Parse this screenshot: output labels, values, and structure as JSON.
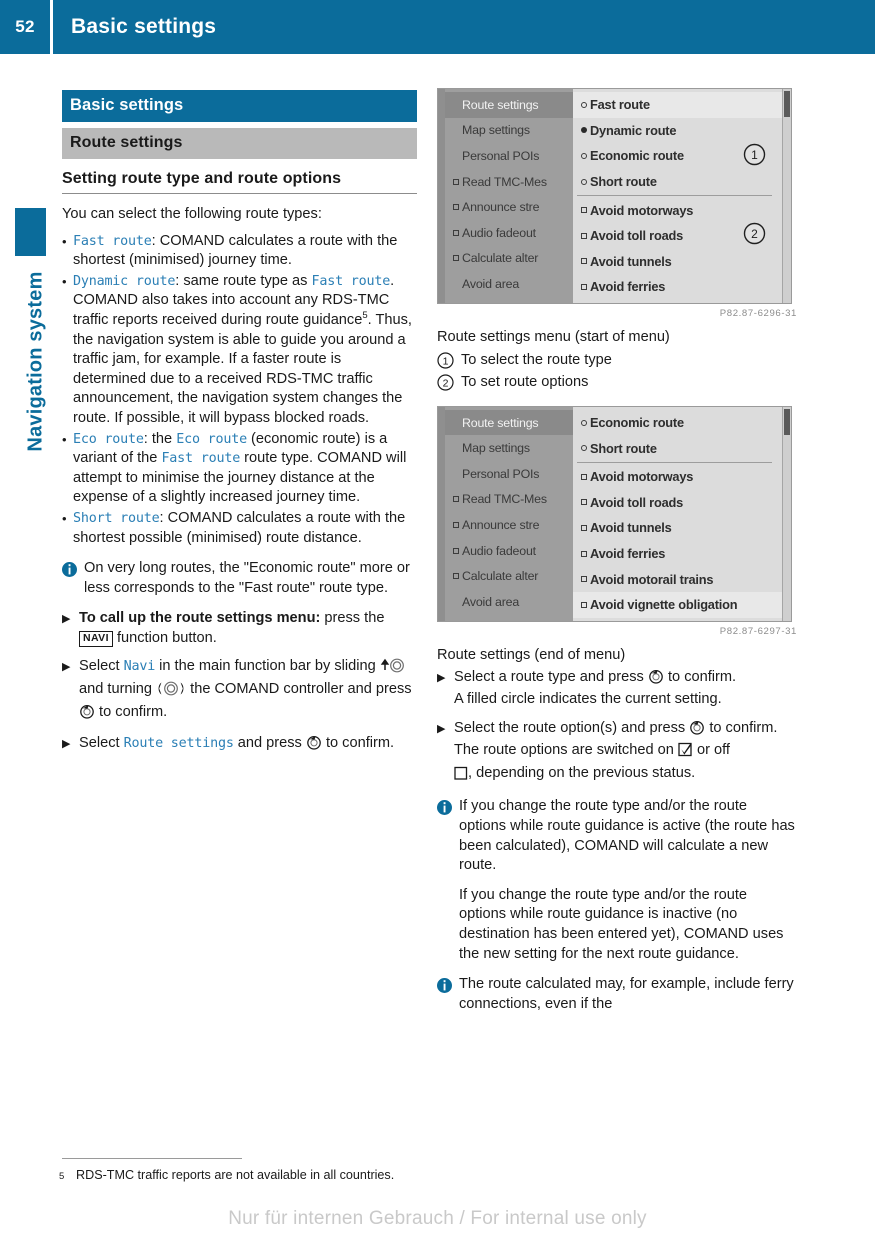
{
  "header": {
    "page_number": "52",
    "title": "Basic settings"
  },
  "chapter_tab": {
    "label": "Navigation system"
  },
  "left_column": {
    "section_bar": "Basic settings",
    "subsection_bar": "Route settings",
    "heading": "Setting route type and route options",
    "intro": "You can select the following route types:",
    "bullets": [
      {
        "term": "Fast route",
        "text": ": COMAND calculates a route with the shortest (minimised) journey time."
      },
      {
        "term": "Dynamic route",
        "text": ": same route type as Fast route. COMAND also takes into account any RDS-TMC traffic reports received during route guidance5. Thus, the navigation system is able to guide you around a traffic jam, for example. If a faster route is determined due to a received RDS-TMC traffic announcement, the navigation system changes the route. If possible, it will bypass blocked roads."
      },
      {
        "term": "Eco route",
        "text": ": the Eco route (economic route) is a variant of the Fast route route type. COMAND will attempt to minimise the journey distance at the expense of a slightly increased journey time."
      },
      {
        "term": "Short route",
        "text": ": COMAND calculates a route with the shortest possible (minimised) route distance."
      }
    ],
    "info_note": "On very long routes, the \"Economic route\" more or less corresponds to the \"Fast route\" route type.",
    "steps": [
      {
        "bold_lead": "To call up the route settings menu:",
        "text": "press the NAVI function button.",
        "button_label": "NAVI"
      },
      {
        "text": "Select Navi in the main function bar by sliding and turning the COMAND controller and press to confirm.",
        "ui_terms": [
          "Navi"
        ]
      },
      {
        "text": "Select Route settings and press to confirm.",
        "ui_terms": [
          "Route settings"
        ]
      }
    ]
  },
  "right_column": {
    "figure_1": {
      "code": "P82.87-6296-31",
      "menu_items": [
        {
          "label": "Route settings",
          "marker": "none",
          "highlighted": true
        },
        {
          "label": "Map settings",
          "marker": "none",
          "highlighted": false
        },
        {
          "label": "Personal POIs",
          "marker": "none",
          "highlighted": false
        },
        {
          "label": "Read TMC-Mes",
          "marker": "square",
          "highlighted": false
        },
        {
          "label": "Announce stre",
          "marker": "square",
          "highlighted": false
        },
        {
          "label": "Audio fadeout",
          "marker": "square",
          "highlighted": false
        },
        {
          "label": "Calculate alter",
          "marker": "square",
          "highlighted": false
        },
        {
          "label": "Avoid area",
          "marker": "none",
          "highlighted": false
        }
      ],
      "list_items": [
        {
          "label": "Fast route",
          "marker": "ring",
          "highlighted": true
        },
        {
          "label": "Dynamic route",
          "marker": "dot",
          "highlighted": false
        },
        {
          "label": "Economic route",
          "marker": "ring",
          "highlighted": false
        },
        {
          "label": "Short route",
          "marker": "ring",
          "highlighted": false
        },
        {
          "separator": true
        },
        {
          "label": "Avoid motorways",
          "marker": "square",
          "highlighted": false
        },
        {
          "label": "Avoid toll roads",
          "marker": "square",
          "highlighted": false
        },
        {
          "label": "Avoid tunnels",
          "marker": "square",
          "highlighted": false
        },
        {
          "label": "Avoid ferries",
          "marker": "square",
          "highlighted": false
        }
      ],
      "callouts": [
        "1",
        "2"
      ]
    },
    "figure_1_caption": "Route settings menu (start of menu)",
    "callout_legend": [
      {
        "number": "1",
        "text": "To select the route type"
      },
      {
        "number": "2",
        "text": "To set route options"
      }
    ],
    "figure_2": {
      "code": "P82.87-6297-31",
      "menu_items": [
        {
          "label": "Route settings",
          "marker": "none",
          "highlighted": true
        },
        {
          "label": "Map settings",
          "marker": "none",
          "highlighted": false
        },
        {
          "label": "Personal POIs",
          "marker": "none",
          "highlighted": false
        },
        {
          "label": "Read TMC-Mes",
          "marker": "square",
          "highlighted": false
        },
        {
          "label": "Announce stre",
          "marker": "square",
          "highlighted": false
        },
        {
          "label": "Audio fadeout",
          "marker": "square",
          "highlighted": false
        },
        {
          "label": "Calculate alter",
          "marker": "square",
          "highlighted": false
        },
        {
          "label": "Avoid area",
          "marker": "none",
          "highlighted": false
        }
      ],
      "list_items": [
        {
          "label": "Economic route",
          "marker": "ring",
          "highlighted": false
        },
        {
          "label": "Short route",
          "marker": "ring",
          "highlighted": false
        },
        {
          "separator": true
        },
        {
          "label": "Avoid motorways",
          "marker": "square",
          "highlighted": false
        },
        {
          "label": "Avoid toll roads",
          "marker": "square",
          "highlighted": false
        },
        {
          "label": "Avoid tunnels",
          "marker": "square",
          "highlighted": false
        },
        {
          "label": "Avoid ferries",
          "marker": "square",
          "highlighted": false
        },
        {
          "label": "Avoid motorail trains",
          "marker": "square",
          "highlighted": false
        },
        {
          "label": "Avoid vignette obligation",
          "marker": "square",
          "highlighted": true
        }
      ]
    },
    "figure_2_caption": "Route settings (end of menu)",
    "steps": [
      {
        "line1": "Select a route type and press",
        "line1_tail": "to confirm.",
        "line2": "A filled circle indicates the current setting."
      },
      {
        "line1": "Select the route option(s) and press",
        "line1_tail": "to confirm.",
        "line2_a": "The route options are switched on",
        "line2_b": "or off",
        "line2_c": ", depending on the previous status."
      }
    ],
    "info_notes": [
      {
        "paragraphs": [
          "If you change the route type and/or the route options while route guidance is active (the route has been calculated), COMAND will calculate a new route.",
          "If you change the route type and/or the route options while route guidance is inactive (no destination has been entered yet), COMAND uses the new setting for the next route guidance."
        ]
      },
      {
        "paragraphs": [
          "The route calculated may, for example, include ferry connections, even if the"
        ]
      }
    ]
  },
  "footnote": {
    "number": "5",
    "text": "RDS-TMC traffic reports are not available in all countries."
  },
  "watermark": "Nur für internen Gebrauch / For internal use only",
  "colors": {
    "brand_blue": "#0b6c9b",
    "ui_term_blue": "#2b7fb5",
    "gray_bar": "#b9b9b9",
    "watermark_gray": "#c9c9c9"
  }
}
